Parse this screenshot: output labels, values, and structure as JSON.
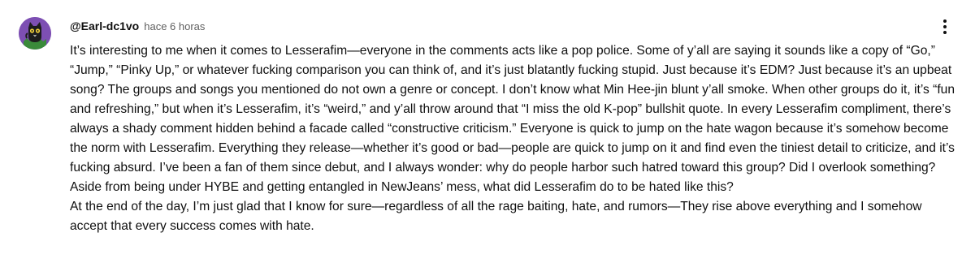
{
  "comment": {
    "author": "@Earl-dc1vo",
    "timestamp": "hace 6 horas",
    "avatar_icon": "avatar-cat-icon",
    "menu_icon": "more-vertical-icon",
    "paragraphs": [
      "It’s interesting to me when it comes to Lesserafim—everyone in the comments acts like a pop police. Some of y’all are saying it sounds like a copy of “Go,” “Jump,” “Pinky Up,” or whatever fucking comparison you can think of, and it’s just blatantly fucking stupid. Just because it’s EDM? Just because it’s an upbeat song? The groups and songs you mentioned do not own a genre or concept. I don’t know what Min Hee-jin blunt y’all smoke. When other groups do it, it’s “fun and refreshing,” but when it’s Lesserafim, it’s “weird,” and y’all throw around that “I miss the old K-pop” bullshit quote. In every Lesserafim compliment, there’s always a shady comment hidden behind a facade called “constructive criticism.” Everyone is quick to jump on the hate wagon because it’s somehow become the norm with Lesserafim. Everything they release—whether it’s good or bad—people are quick to jump on it and find even the tiniest detail to criticize, and it’s fucking absurd. I’ve been a fan of them since debut, and I always wonder: why do people harbor such hatred toward this group? Did I overlook something? Aside from being under HYBE and getting entangled in NewJeans’ mess, what did Lesserafim do to be hated like this?",
      "At the end of the day, I’m just glad that I know for sure—regardless of all the rage baiting, hate, and rumors—They rise above everything and I somehow accept that every success comes with hate."
    ]
  }
}
